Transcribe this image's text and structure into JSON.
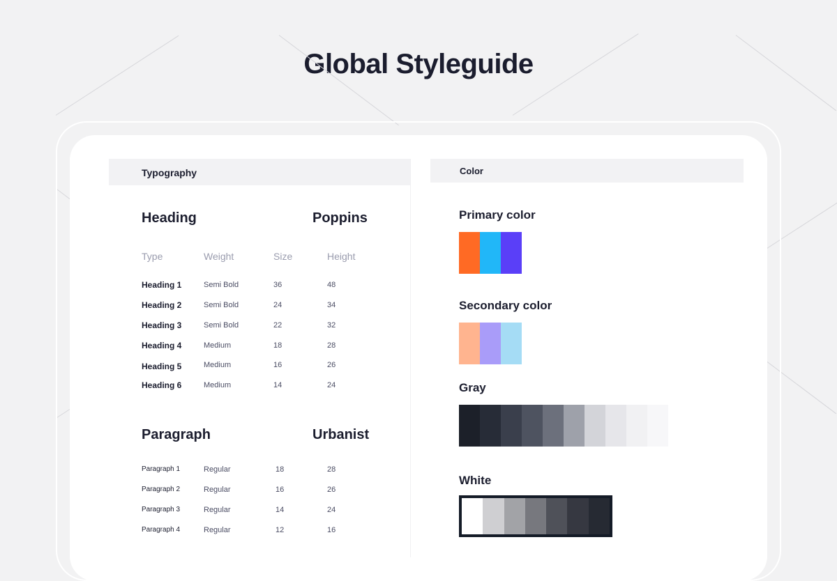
{
  "page": {
    "title": "Global Styleguide"
  },
  "typography": {
    "section_label": "Typography",
    "heading_block": {
      "title": "Heading",
      "font": "Poppins",
      "columns": [
        "Type",
        "Weight",
        "Size",
        "Height"
      ],
      "rows": [
        {
          "type": "Heading 1",
          "weight": "Semi Bold",
          "size": "36",
          "height": "48"
        },
        {
          "type": "Heading 2",
          "weight": "Semi Bold",
          "size": "24",
          "height": "34"
        },
        {
          "type": "Heading 3",
          "weight": "Semi Bold",
          "size": "22",
          "height": "32"
        },
        {
          "type": "Heading 4",
          "weight": "Medium",
          "size": "18",
          "height": "28"
        },
        {
          "type": "Heading 5",
          "weight": "Medium",
          "size": "16",
          "height": "26"
        },
        {
          "type": "Heading 6",
          "weight": "Medium",
          "size": "14",
          "height": "24"
        }
      ]
    },
    "paragraph_block": {
      "title": "Paragraph",
      "font": "Urbanist",
      "rows": [
        {
          "type": "Paragraph 1",
          "weight": "Regular",
          "size": "18",
          "height": "28"
        },
        {
          "type": "Paragraph 2",
          "weight": "Regular",
          "size": "16",
          "height": "26"
        },
        {
          "type": "Paragraph 3",
          "weight": "Regular",
          "size": "14",
          "height": "24"
        },
        {
          "type": "Paragraph 4",
          "weight": "Regular",
          "size": "12",
          "height": "16"
        }
      ]
    }
  },
  "color": {
    "section_label": "Color",
    "primary": {
      "title": "Primary color",
      "swatches": [
        "#ff6a24",
        "#21b7f8",
        "#5a3ff8"
      ]
    },
    "secondary": {
      "title": "Secondary color",
      "swatches": [
        "#ffb48f",
        "#a99cf9",
        "#a5dcf5"
      ]
    },
    "gray": {
      "title": "Gray",
      "swatches": [
        "#1c2029",
        "#272c37",
        "#3a3f4c",
        "#4e5360",
        "#6c707c",
        "#9ea1aa",
        "#d3d4d9",
        "#e6e6ea",
        "#f1f1f3",
        "#f7f7f9"
      ]
    },
    "white": {
      "title": "White",
      "swatches": [
        "#ffffff",
        "#cfcfd2",
        "#a2a3a7",
        "#77787e",
        "#4f5159",
        "#363841",
        "#262a33"
      ]
    }
  }
}
